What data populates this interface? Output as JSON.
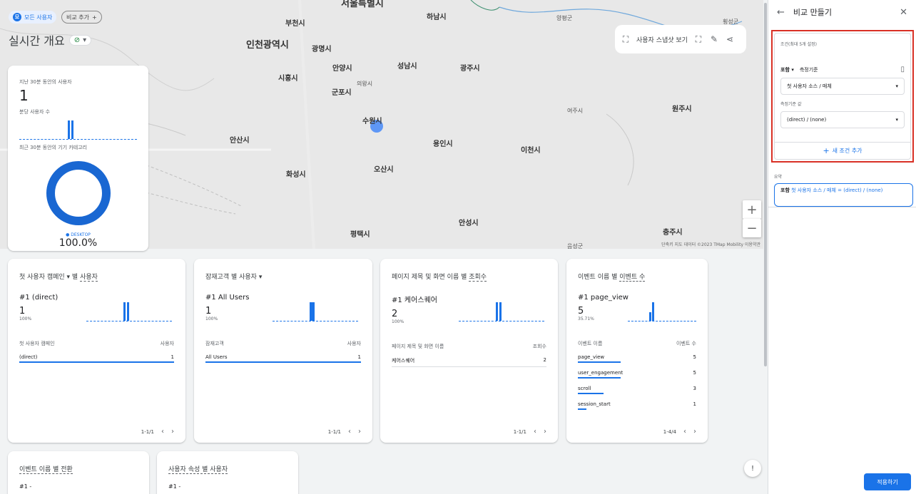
{
  "header": {
    "all_users": "모든 사용자",
    "all_users_badge": "모",
    "add_comparison": "비교 추가",
    "page_title": "실시간 개요"
  },
  "map": {
    "cities": [
      {
        "name": "서울특별시",
        "size": "lg"
      },
      {
        "name": "하남시",
        "size": "md"
      },
      {
        "name": "양평군",
        "size": "sm"
      },
      {
        "name": "횡성군",
        "size": "sm"
      },
      {
        "name": "부천시",
        "size": "md"
      },
      {
        "name": "인천광역시",
        "size": "lg"
      },
      {
        "name": "광명시",
        "size": "md"
      },
      {
        "name": "안양시",
        "size": "md"
      },
      {
        "name": "성남시",
        "size": "md"
      },
      {
        "name": "광주시",
        "size": "md"
      },
      {
        "name": "시흥시",
        "size": "md"
      },
      {
        "name": "의왕시",
        "size": "sm"
      },
      {
        "name": "군포시",
        "size": "md"
      },
      {
        "name": "여주시",
        "size": "sm"
      },
      {
        "name": "원주시",
        "size": "md"
      },
      {
        "name": "수원시",
        "size": "md"
      },
      {
        "name": "안산시",
        "size": "md"
      },
      {
        "name": "용인시",
        "size": "md"
      },
      {
        "name": "이천시",
        "size": "md"
      },
      {
        "name": "오산시",
        "size": "md"
      },
      {
        "name": "화성시",
        "size": "md"
      },
      {
        "name": "안성시",
        "size": "md"
      },
      {
        "name": "평택시",
        "size": "md"
      },
      {
        "name": "충주시",
        "size": "md"
      },
      {
        "name": "음성군",
        "size": "sm"
      }
    ],
    "footer": "단축키   지도 데이터 ©2023 TMap Mobility   이용약관",
    "snapshot_label": "사용자 스냅샷 보기"
  },
  "overview": {
    "users_30min_label": "지난 30분 동안의 사용자",
    "users_30min_value": "1",
    "per_minute_label": "분당 사용자 수",
    "device_label": "최근 30분 동안의 기기 카테고리",
    "device_name": "● DESKTOP",
    "device_pct": "100.0%"
  },
  "cards": [
    {
      "title_pre": "첫 사용자 캠페인 ▾ 별 ",
      "title_u": "사용자",
      "top": "#1 (direct)",
      "value": "1",
      "pct": "100%",
      "col1": "첫 사용자 캠페인",
      "col2": "사용자",
      "rows": [
        {
          "k": "(direct)",
          "v": "1"
        }
      ],
      "pager": "1-1/1"
    },
    {
      "title_pre": "잠재고객 별 사용자 ▾",
      "title_u": "",
      "top": "#1 All Users",
      "value": "1",
      "pct": "100%",
      "col1": "잠재고객",
      "col2": "사용자",
      "rows": [
        {
          "k": "All Users",
          "v": "1"
        }
      ],
      "pager": "1-1/1"
    },
    {
      "title_pre": "페이지 제목 및 화면 이름 별 ",
      "title_u": "조회수",
      "top": "#1 케어스퀘어",
      "value": "2",
      "pct": "100%",
      "col1": "페이지 제목 및 화면 이름",
      "col2": "조회수",
      "rows": [
        {
          "k": "케어스퀘어",
          "v": "2"
        }
      ],
      "pager": "1-1/1"
    },
    {
      "title_pre": "이벤트 이름 별 ",
      "title_u": "이벤트 수",
      "top": "#1 page_view",
      "value": "5",
      "pct": "35.71%",
      "col1": "이벤트 이름",
      "col2": "이벤트 수",
      "rows": [
        {
          "k": "page_view",
          "v": "5"
        },
        {
          "k": "user_engagement",
          "v": "5"
        },
        {
          "k": "scroll",
          "v": "3"
        },
        {
          "k": "session_start",
          "v": "1"
        }
      ],
      "pager": "1-4/4"
    }
  ],
  "bottom_cards": [
    {
      "title": "이벤트 이름 별 전환",
      "top": "#1 -"
    },
    {
      "title": "사용자 속성 별 사용자",
      "top": "#1 -"
    }
  ],
  "panel": {
    "title": "비교 만들기",
    "cond_label": "조건(최대 5개 설정)",
    "include": "포함 ▾",
    "dimension_label": "측정기준",
    "dimension_value": "첫 사용자 소스 / 매체",
    "dim_value_label": "측정기준 값",
    "dim_value": "(direct) / (none)",
    "add_condition": "새 조건 추가",
    "summary_label": "요약",
    "summary_bold": "포함",
    "summary_text": " 첫 사용자 소스 / 매체 = (direct) / (none)",
    "apply": "적용하기"
  }
}
